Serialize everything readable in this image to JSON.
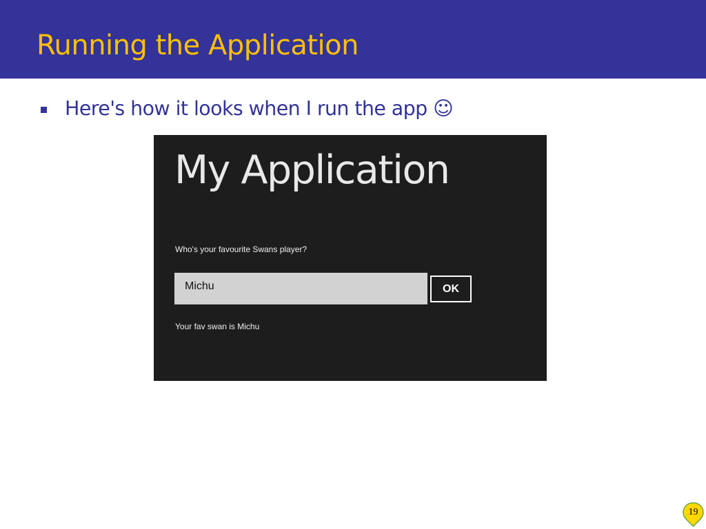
{
  "slide": {
    "title": "Running the Application",
    "bullet_text": "Here's how it looks when I run the app ☺",
    "page_number": "19"
  },
  "app": {
    "title": "My Application",
    "question": "Who's your favourite Swans player?",
    "input_value": "Michu",
    "ok_label": "OK",
    "result": "Your fav swan is Michu"
  },
  "colors": {
    "header_bg": "#333399",
    "title_text": "#ffc000",
    "body_text": "#333399",
    "app_bg": "#1d1d1d",
    "input_bg": "#d2d2d2",
    "badge_fill": "#ffd700",
    "badge_stroke": "#66aa44"
  }
}
